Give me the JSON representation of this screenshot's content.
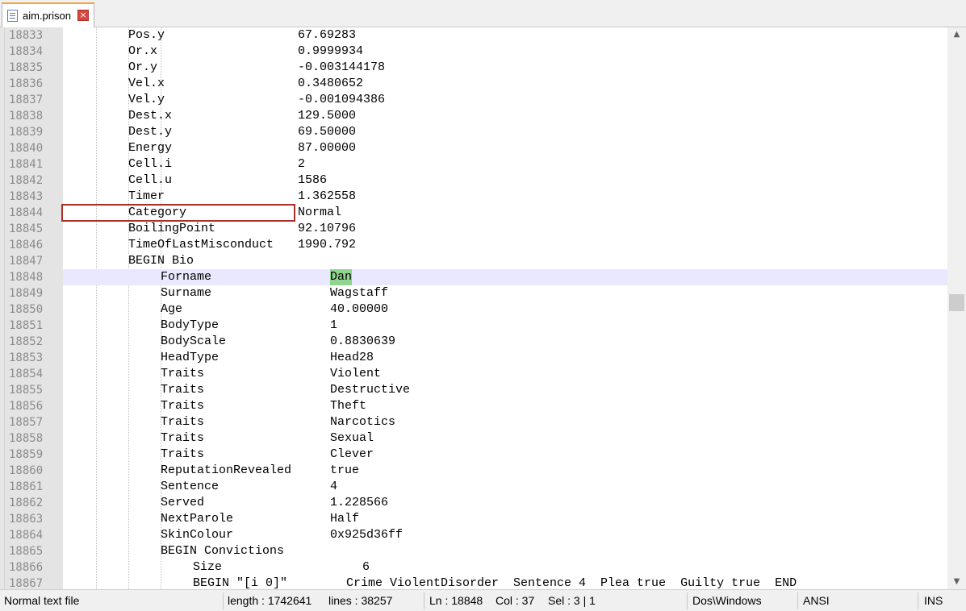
{
  "tab": {
    "filename": "aim.prison",
    "close_glyph": "×",
    "icon": "document-icon"
  },
  "editor": {
    "current_line": "18848",
    "selected_text": "Dan",
    "lines": [
      {
        "num": "18833",
        "key": "Pos.y",
        "value": "67.69283"
      },
      {
        "num": "18834",
        "key": "Or.x",
        "value": "0.9999934"
      },
      {
        "num": "18835",
        "key": "Or.y",
        "value": "-0.003144178"
      },
      {
        "num": "18836",
        "key": "Vel.x",
        "value": "0.3480652"
      },
      {
        "num": "18837",
        "key": "Vel.y",
        "value": "-0.001094386"
      },
      {
        "num": "18838",
        "key": "Dest.x",
        "value": "129.5000"
      },
      {
        "num": "18839",
        "key": "Dest.y",
        "value": "69.50000"
      },
      {
        "num": "18840",
        "key": "Energy",
        "value": "87.00000"
      },
      {
        "num": "18841",
        "key": "Cell.i",
        "value": "2"
      },
      {
        "num": "18842",
        "key": "Cell.u",
        "value": "1586"
      },
      {
        "num": "18843",
        "key": "Timer",
        "value": "1.362558"
      },
      {
        "num": "18844",
        "key": "Category",
        "value": "Normal"
      },
      {
        "num": "18845",
        "key": "BoilingPoint",
        "value": "92.10796"
      },
      {
        "num": "18846",
        "key": "TimeOfLastMisconduct",
        "value": "1990.792"
      },
      {
        "num": "18847",
        "key": "BEGIN Bio",
        "value": ""
      },
      {
        "num": "18848",
        "key": "Forname",
        "value": "Dan"
      },
      {
        "num": "18849",
        "key": "Surname",
        "value": "Wagstaff"
      },
      {
        "num": "18850",
        "key": "Age",
        "value": "40.00000"
      },
      {
        "num": "18851",
        "key": "BodyType",
        "value": "1"
      },
      {
        "num": "18852",
        "key": "BodyScale",
        "value": "0.8830639"
      },
      {
        "num": "18853",
        "key": "HeadType",
        "value": "Head28"
      },
      {
        "num": "18854",
        "key": "Traits",
        "value": "Violent"
      },
      {
        "num": "18855",
        "key": "Traits",
        "value": "Destructive"
      },
      {
        "num": "18856",
        "key": "Traits",
        "value": "Theft"
      },
      {
        "num": "18857",
        "key": "Traits",
        "value": "Narcotics"
      },
      {
        "num": "18858",
        "key": "Traits",
        "value": "Sexual"
      },
      {
        "num": "18859",
        "key": "Traits",
        "value": "Clever"
      },
      {
        "num": "18860",
        "key": "ReputationRevealed",
        "value": "true"
      },
      {
        "num": "18861",
        "key": "Sentence",
        "value": "4"
      },
      {
        "num": "18862",
        "key": "Served",
        "value": "1.228566"
      },
      {
        "num": "18863",
        "key": "NextParole",
        "value": "Half"
      },
      {
        "num": "18864",
        "key": "SkinColour",
        "value": "0x925d36ff"
      },
      {
        "num": "18865",
        "key": "BEGIN Convictions",
        "value": ""
      },
      {
        "num": "18866",
        "key": "Size",
        "value": "6"
      },
      {
        "num": "18867",
        "key": "BEGIN \"[i 0]\"",
        "value": "Crime ViolentDisorder  Sentence 4  Plea true  Guilty true  END"
      }
    ]
  },
  "status": {
    "file_type": "Normal text file",
    "length": "length : 1742641",
    "lines": "lines : 38257",
    "ln": "Ln : 18848",
    "col": "Col : 37",
    "sel": "Sel : 3 | 1",
    "eol": "Dos\\Windows",
    "encoding": "ANSI",
    "mode": "INS"
  },
  "colors": {
    "highlight_box": "#a93226",
    "current_line_bg": "#e8e8ff",
    "selection_bg": "#8fd48f",
    "tab_accent": "#f9a33c"
  }
}
